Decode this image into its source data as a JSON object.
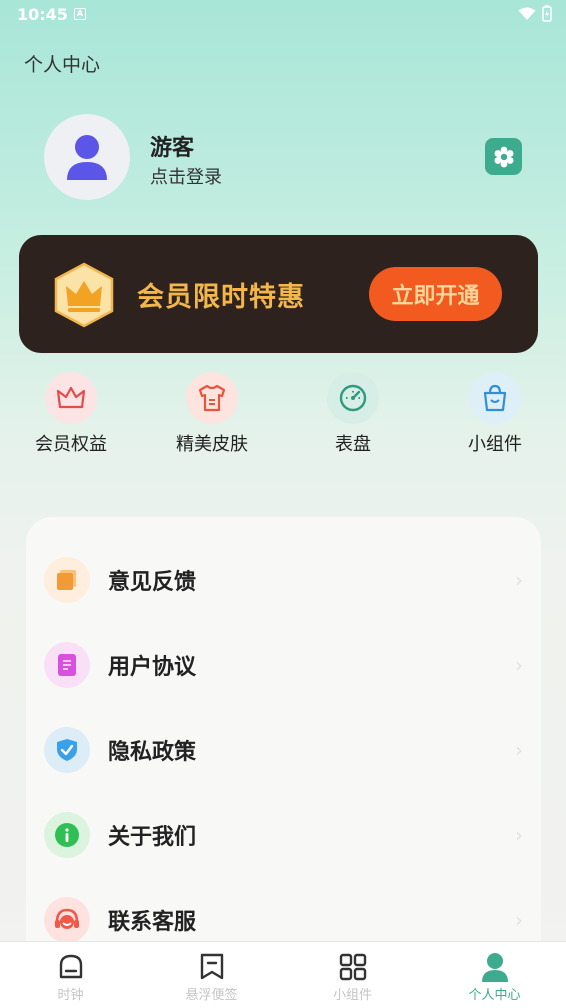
{
  "status_bar": {
    "time": "10:45",
    "notif": "A"
  },
  "header": {
    "title": "个人中心"
  },
  "profile": {
    "name": "游客",
    "login_hint": "点击登录"
  },
  "vip": {
    "promo_text": "会员限时特惠",
    "cta_label": "立即开通",
    "color": "#f2b64a",
    "button_color": "#f25a1f"
  },
  "features": [
    {
      "label": "会员权益",
      "icon": "crown-icon",
      "bg": "#fde4e4"
    },
    {
      "label": "精美皮肤",
      "icon": "shirt-icon",
      "bg": "#fde4de"
    },
    {
      "label": "表盘",
      "icon": "dial-icon",
      "bg": "#d7eee6"
    },
    {
      "label": "小组件",
      "icon": "bag-icon",
      "bg": "#dfeff8"
    }
  ],
  "menu": [
    {
      "label": "意见反馈",
      "icon": "feedback-icon"
    },
    {
      "label": "用户协议",
      "icon": "agreement-icon"
    },
    {
      "label": "隐私政策",
      "icon": "shield-icon"
    },
    {
      "label": "关于我们",
      "icon": "info-icon"
    },
    {
      "label": "联系客服",
      "icon": "headset-icon"
    }
  ],
  "bottom_nav": [
    {
      "label": "时钟",
      "icon": "clock-icon",
      "active": false
    },
    {
      "label": "悬浮便签",
      "icon": "bookmark-icon",
      "active": false
    },
    {
      "label": "小组件",
      "icon": "grid-icon",
      "active": false
    },
    {
      "label": "个人中心",
      "icon": "person-icon",
      "active": true
    }
  ],
  "colors": {
    "accent": "#3dab8e",
    "banner_bg": "#2e221f"
  }
}
